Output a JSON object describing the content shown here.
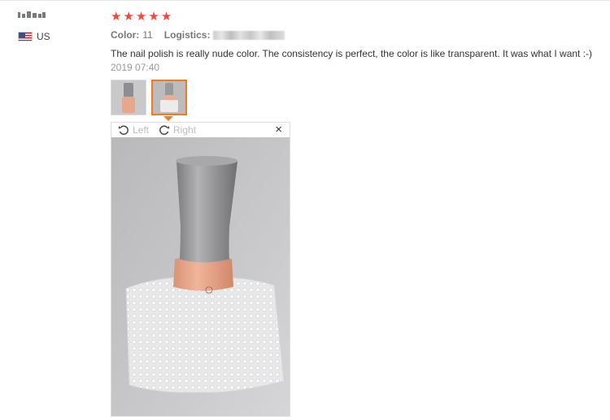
{
  "review": {
    "rating": 5,
    "stars": [
      "★",
      "★",
      "★",
      "★",
      "★"
    ],
    "color_label": "Color:",
    "color_value": "11",
    "logistics_label": "Logistics:",
    "text": "The nail polish is really nude color. The consistency is perfect, the color is like transparent. It was what I want :-)",
    "date": "2019 07:40"
  },
  "user": {
    "country": "US",
    "flag": "us-flag-icon"
  },
  "viewer": {
    "rotate_left_label": "Left",
    "rotate_right_label": "Right",
    "close_symbol": "×",
    "thumbnail_count": 2,
    "selected_thumbnail": 2
  },
  "colors": {
    "star": "#f2473f",
    "active_border": "#f47a20",
    "muted_text": "#999999"
  }
}
